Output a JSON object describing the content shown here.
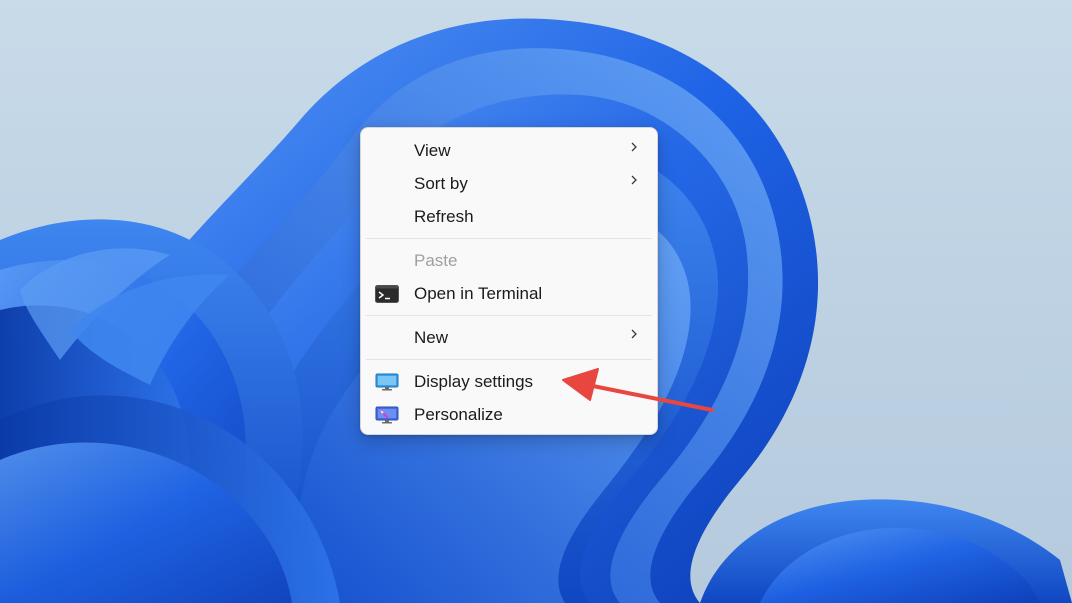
{
  "context_menu": {
    "items": [
      {
        "label": "View",
        "has_submenu": true,
        "disabled": false,
        "icon": null
      },
      {
        "label": "Sort by",
        "has_submenu": true,
        "disabled": false,
        "icon": null
      },
      {
        "label": "Refresh",
        "has_submenu": false,
        "disabled": false,
        "icon": null
      },
      {
        "label": "Paste",
        "has_submenu": false,
        "disabled": true,
        "icon": null
      },
      {
        "label": "Open in Terminal",
        "has_submenu": false,
        "disabled": false,
        "icon": "terminal-icon"
      },
      {
        "label": "New",
        "has_submenu": true,
        "disabled": false,
        "icon": null
      },
      {
        "label": "Display settings",
        "has_submenu": false,
        "disabled": false,
        "icon": "display-settings-icon"
      },
      {
        "label": "Personalize",
        "has_submenu": false,
        "disabled": false,
        "icon": "personalize-icon"
      }
    ]
  },
  "annotation": {
    "arrow_color": "#e8473f",
    "points_to": "Display settings"
  },
  "colors": {
    "wallpaper_blue": "#1a5fe0",
    "wallpaper_light": "#4f8ff2",
    "background": "#c4d7e7",
    "menu_bg": "#f9f9f9",
    "disabled_text": "#a0a0a0"
  }
}
